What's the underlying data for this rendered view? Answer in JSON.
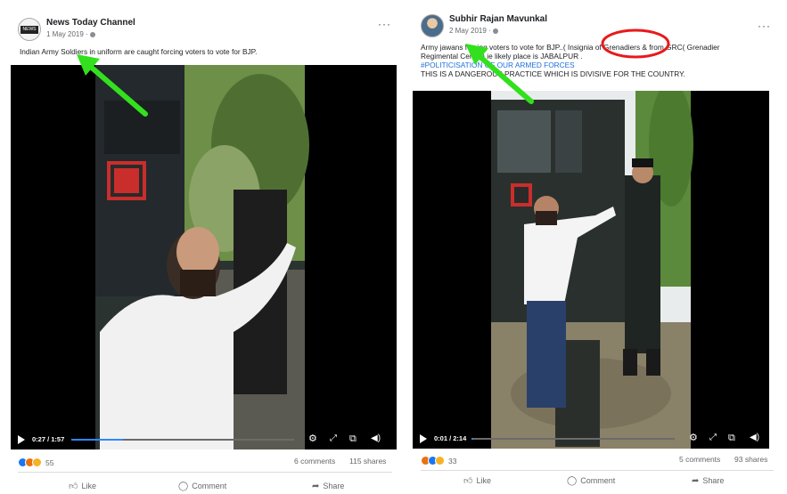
{
  "colors": {
    "arrow": "#33e01e",
    "circle": "#e8191b",
    "progress": "#2d88ff",
    "hashtag": "#216fdb"
  },
  "left_post": {
    "author": "News Today Channel",
    "avatar_text": "NEWS",
    "date": "1 May 2019 ·",
    "more_label": "···",
    "text": "Indian Army Soldiers in uniform are caught forcing voters to vote for BJP.",
    "video": {
      "timecode": "0:27 / 1:57",
      "progress_fraction": 0.23,
      "controls_icons": [
        "play-icon",
        "settings-icon",
        "expand-icon",
        "picture-in-picture-icon",
        "volume-icon"
      ]
    },
    "reactions": {
      "icons": [
        "like",
        "angry",
        "haha"
      ],
      "count": "55"
    },
    "comments": "6 comments",
    "shares": "115 shares",
    "actions": {
      "like": "Like",
      "comment": "Comment",
      "share": "Share"
    }
  },
  "right_post": {
    "author": "Subhir Rajan Mavunkal",
    "date": "2 May 2019 ·",
    "more_label": "···",
    "text_line1": "Army jawans forcing voters to vote for BJP..( Insignia of Grenadiers & from GRC( Grenadier",
    "text_line2": "Regimental Centre) ie likely place is JABALPUR .",
    "hashtag_line": "#POLITICISATION OF OUR ARMED FORCES",
    "text_line4": "THIS IS A DANGEROUS PRACTICE WHICH IS DIVISIVE FOR THE COUNTRY.",
    "video": {
      "timecode": "0:01 / 2:14",
      "progress_fraction": 0.01,
      "controls_icons": [
        "play-icon",
        "settings-icon",
        "expand-icon",
        "picture-in-picture-icon",
        "volume-icon"
      ]
    },
    "reactions": {
      "icons": [
        "angry",
        "like",
        "haha"
      ],
      "count": "33"
    },
    "comments": "5 comments",
    "shares": "93 shares",
    "actions": {
      "like": "Like",
      "comment": "Comment",
      "share": "Share"
    }
  }
}
